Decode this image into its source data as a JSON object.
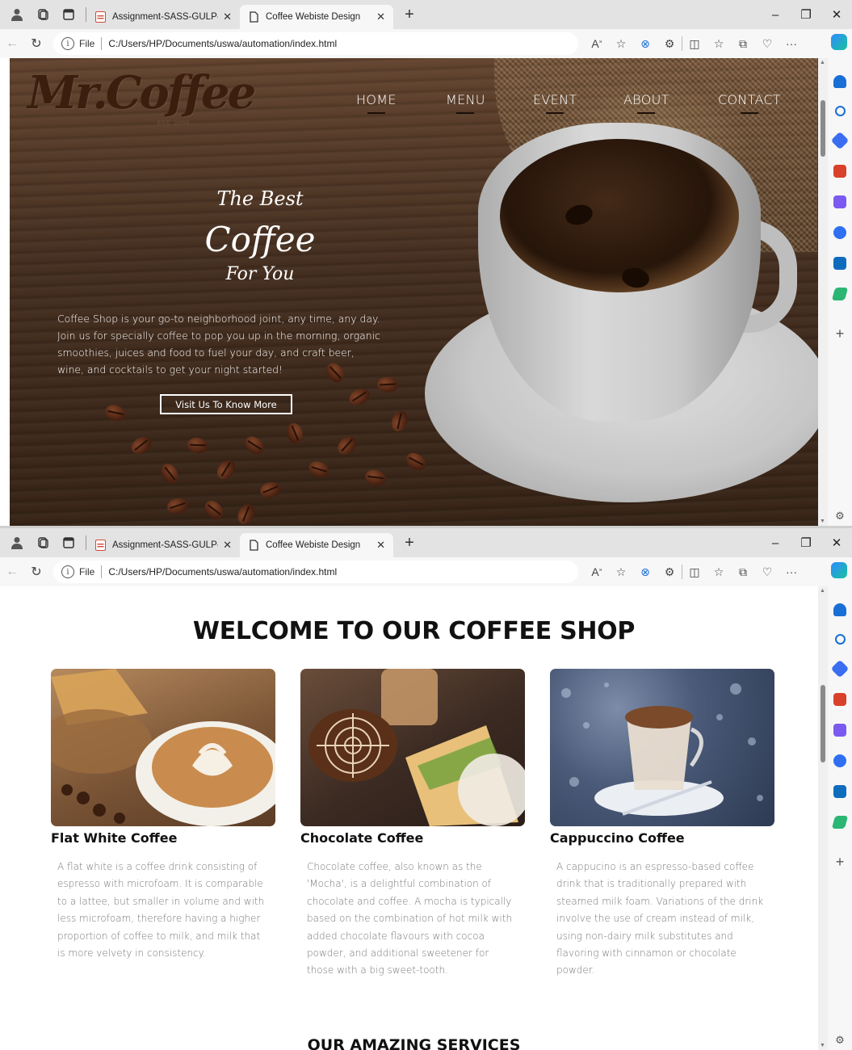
{
  "browser": {
    "tabs": [
      {
        "title": "Assignment-SASS-GULP-AUTOM",
        "active": false
      },
      {
        "title": "Coffee Webiste Design",
        "active": true
      }
    ],
    "url_label": "File",
    "url": "C:/Users/HP/Documents/uswa/automation/index.html"
  },
  "hero": {
    "logo": "Mr.Coffee",
    "logo_est": "EST. 2008",
    "nav": [
      "HOME",
      "MENU",
      "EVENT",
      "ABOUT",
      "CONTACT"
    ],
    "title_line1": "The Best",
    "title_line2": "Coffee",
    "title_line3": "For You",
    "description": "Coffee Shop is your go-to neighborhood joint, any time, any day. Join us for specially coffee to pop you up in the morning, organic smoothies, juices and food to fuel your day, and craft beer, wine, and cocktails to get your night started!",
    "button": "Visit Us To Know More"
  },
  "welcome": {
    "heading": "WELCOME TO OUR COFFEE SHOP",
    "cards": [
      {
        "title": "Flat White Coffee",
        "text": "A flat white is a coffee drink consisting of espresso with microfoam. It is comparable to a lattee, but smaller in volume and with less microfoam, therefore having a higher proportion of coffee to milk, and milk that is more velvety in consistency."
      },
      {
        "title": "Chocolate Coffee",
        "text": "Chocolate coffee, also known as the 'Mocha', is a delightful combination of chocolate and coffee. A mocha is typically based on the combination of hot milk with added chocolate flavours with cocoa powder, and additional sweetener for those with a big sweet-tooth."
      },
      {
        "title": "Cappuccino Coffee",
        "text": "A cappucino is an espresso-based coffee drink that is traditionally prepared with steamed milk foam. Variations of the drink involve the use of cream instead of milk, using non-dairy milk substitutes and flavoring with cinnamon or chocolate powder."
      }
    ],
    "services_heading": "OUR AMAZING SERVICES"
  },
  "colors": {
    "accent_dark": "#3b1e0e",
    "tabstrip": "#e3e3e3"
  }
}
